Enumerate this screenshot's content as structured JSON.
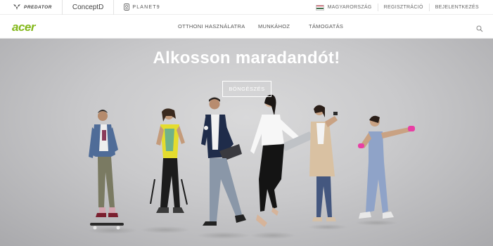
{
  "brands": {
    "predator": "PREDATOR",
    "conceptd": "ConceptD",
    "planet9": "PLANET9"
  },
  "top_links": {
    "country": "MAGYARORSZÁG",
    "register": "REGISZTRÁCIÓ",
    "login": "BEJELENTKEZÉS"
  },
  "logo": "acer",
  "nav": {
    "home": "OTTHONI HASZNÁLATRA",
    "work": "MUNKÁHOZ",
    "support": "TÁMOGATÁS"
  },
  "hero": {
    "title": "Alkosson maradandót!",
    "button": "BÖNGÉSZÉS"
  },
  "colors": {
    "acer_green": "#83b81a",
    "flag_red": "#cd2a3e",
    "flag_white": "#ffffff",
    "flag_green": "#436f4d"
  },
  "icons": {
    "predator": "predator-logo-icon",
    "planet9": "planet9-logo-icon",
    "flag": "hungary-flag-icon",
    "search": "search-icon"
  }
}
